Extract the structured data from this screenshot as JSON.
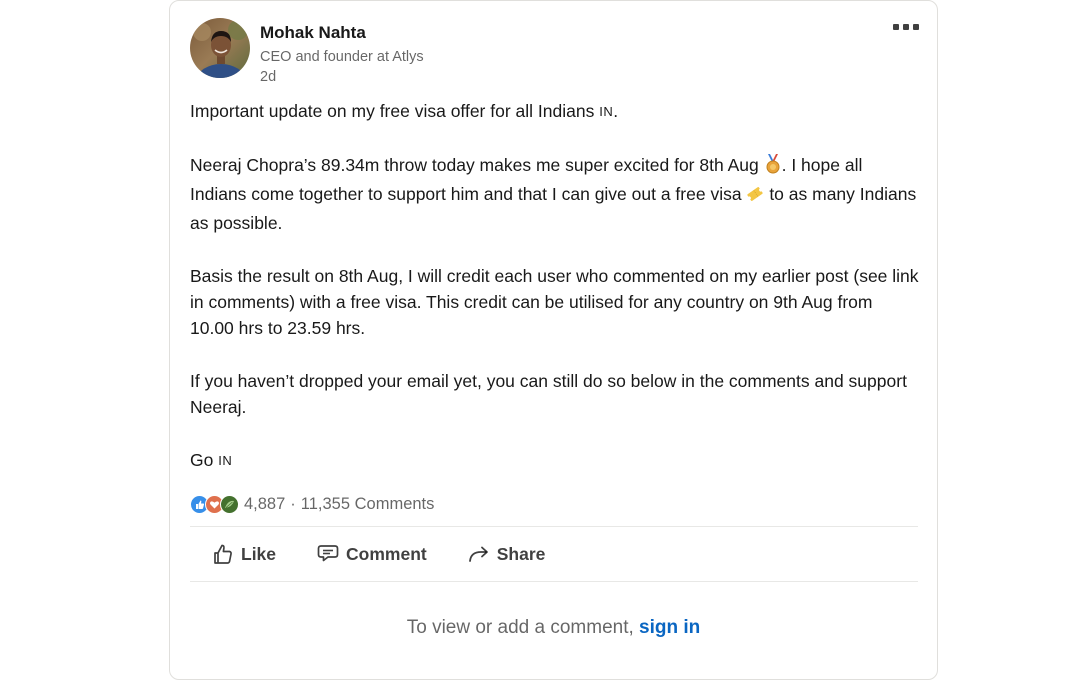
{
  "post": {
    "author": {
      "name": "Mohak Nahta",
      "headline": "CEO and founder at Atlys",
      "time": "2d"
    },
    "body": {
      "p1_text": "Important update on my free visa offer for all Indians",
      "flag": "IN",
      "p1_end": ".",
      "p2_a": "Neeraj Chopra’s 89.34m throw today makes me super excited for 8th Aug",
      "p2_b": ". I hope all Indians come together to support him and that I can give out a free visa",
      "p2_c": " to as many Indians as possible.",
      "p3": "Basis the result on 8th Aug, I will credit each user who commented on my earlier post (see link in comments) with a free visa. This credit can be utilised for any country on 9th Aug from 10.00 hrs to 23.59 hrs.",
      "p4": "If you haven’t dropped your email yet, you can still do so below in the comments and support Neeraj.",
      "p5_text": "Go",
      "p5_flag": "IN"
    },
    "social": {
      "reactions_count": "4,887",
      "separator": "·",
      "comments_count": "11,355 Comments"
    },
    "actions": {
      "like": "Like",
      "comment": "Comment",
      "share": "Share"
    },
    "signin": {
      "prompt": "To view or add a comment,",
      "link": "sign in"
    }
  },
  "colors": {
    "link": "#0a66c2",
    "like_reaction": "#378fe9",
    "love_reaction": "#df704d",
    "support_reaction": "#44712e"
  },
  "icons": {
    "medal": "medal-icon",
    "ticket": "ticket-icon",
    "more": "more-horizontal-icon"
  }
}
